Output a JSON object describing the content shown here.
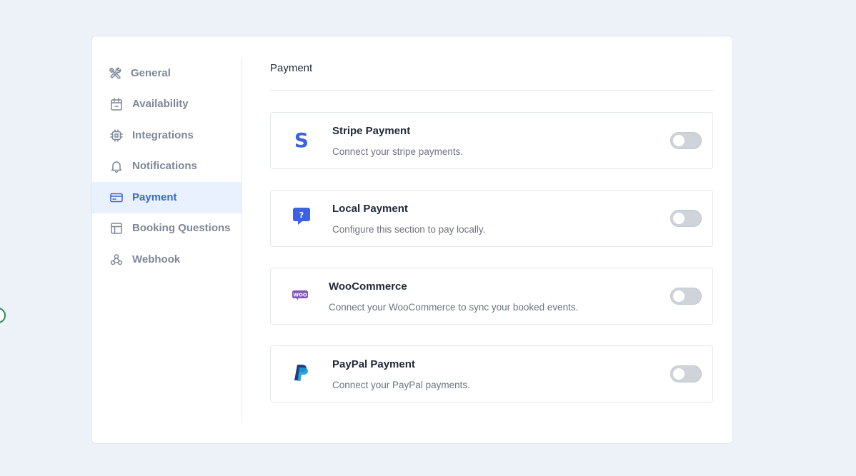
{
  "sidebar": {
    "items": [
      {
        "label": "General",
        "icon": "tools-icon",
        "active": false
      },
      {
        "label": "Availability",
        "icon": "calendar-icon",
        "active": false
      },
      {
        "label": "Integrations",
        "icon": "chip-icon",
        "active": false
      },
      {
        "label": "Notifications",
        "icon": "bell-icon",
        "active": false
      },
      {
        "label": "Payment",
        "icon": "credit-card-icon",
        "active": true
      },
      {
        "label": "Booking Questions",
        "icon": "layout-icon",
        "active": false
      },
      {
        "label": "Webhook",
        "icon": "webhook-icon",
        "active": false
      }
    ]
  },
  "main": {
    "title": "Payment",
    "methods": [
      {
        "title": "Stripe Payment",
        "description": "Connect your stripe payments.",
        "icon": "stripe-icon",
        "enabled": false
      },
      {
        "title": "Local Payment",
        "description": "Configure this section to pay locally.",
        "icon": "chat-question-icon",
        "enabled": false
      },
      {
        "title": "WooCommerce",
        "description": "Connect your WooCommerce to sync your booked events.",
        "icon": "woocommerce-icon",
        "enabled": false
      },
      {
        "title": "PayPal Payment",
        "description": "Connect your PayPal payments.",
        "icon": "paypal-icon",
        "enabled": false
      }
    ]
  },
  "colors": {
    "accent": "#3a66dc",
    "background": "#edf1f8",
    "active_bg": "#e8f1fd",
    "muted_text": "#7d8796",
    "toggle_off": "#cfd4db"
  }
}
